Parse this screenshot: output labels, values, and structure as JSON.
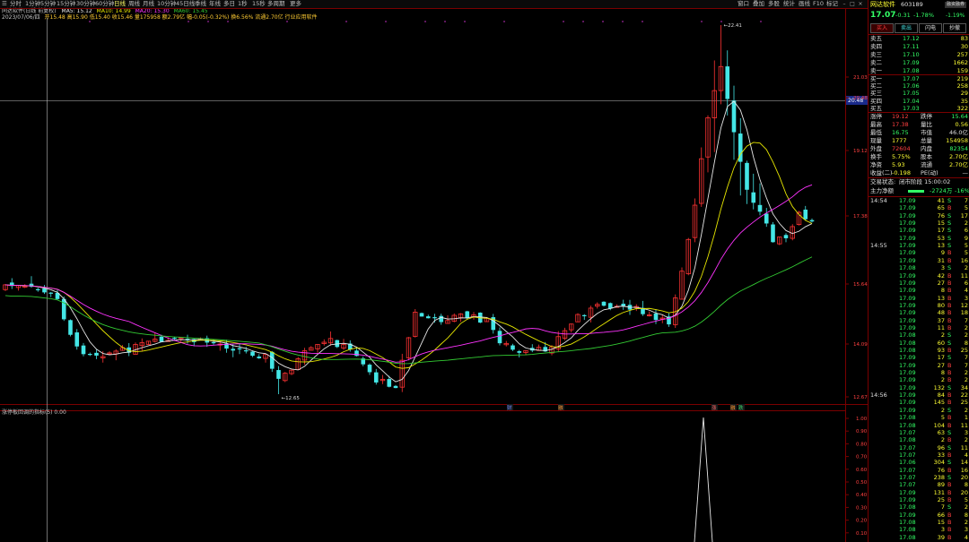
{
  "toolbar": {
    "items": [
      "日线",
      "分时",
      "1分钟",
      "5分钟",
      "15分钟",
      "30分钟",
      "60分钟",
      "日线",
      "周线",
      "月线",
      "10分钟",
      "45日线",
      "季线",
      "年线",
      "多日",
      "1秒",
      "15秒",
      "多周期",
      "更多"
    ],
    "right_items": [
      "窗口",
      "叠加",
      "多股",
      "统计",
      "画线",
      "F10",
      "标记"
    ],
    "window_buttons": [
      "–",
      "□",
      "×"
    ]
  },
  "chart_header": {
    "title_line": "同达软件(日线 前复权)",
    "ma_label": "MA5: 15.12",
    "ma10_label": "MA10: 14.99",
    "ma20_label": "MA20: 15.30",
    "ma60_label": "MA60: 15.45",
    "info_line_date": "2023/07/06/四",
    "info_line_rest": "开15.48 高15.90 低15.40 收15.46 量175958 额2.79亿 幅-0.05(-0.32%) 换6.56% 流通2.70亿 行业应用软件"
  },
  "y_axis_main": [
    "21.03",
    "20.48",
    "19.12",
    "17.38",
    "15.64",
    "14.09",
    "12.67"
  ],
  "price_cursor": "20.48",
  "annotations": {
    "high": "22.41",
    "low": "12.65"
  },
  "event_markers": [
    "财",
    "融",
    "涨",
    "融",
    "跌"
  ],
  "indicator_header": "涨停板回调的指标(5)  0.00",
  "y_axis_indicator": [
    "1.00",
    "0.90",
    "0.80",
    "0.70",
    "0.60",
    "0.50",
    "0.40",
    "0.30",
    "0.20",
    "0.10"
  ],
  "panel": {
    "name": "网达软件",
    "code": "603189",
    "tag": "融资融券",
    "price": "17.07",
    "change": "-0.31",
    "change_pct": "-1.78%",
    "pct_badge": "-1.19%",
    "buttons": [
      "买入",
      "卖出",
      "闪电",
      "抄撤"
    ],
    "asks": [
      {
        "label": "卖五",
        "price": "17.12",
        "vol": "83"
      },
      {
        "label": "卖四",
        "price": "17.11",
        "vol": "30"
      },
      {
        "label": "卖三",
        "price": "17.10",
        "vol": "257"
      },
      {
        "label": "卖二",
        "price": "17.09",
        "vol": "1662"
      },
      {
        "label": "卖一",
        "price": "17.08",
        "vol": "159"
      }
    ],
    "bids": [
      {
        "label": "买一",
        "price": "17.07",
        "vol": "219"
      },
      {
        "label": "买二",
        "price": "17.06",
        "vol": "258"
      },
      {
        "label": "买三",
        "price": "17.05",
        "vol": "29"
      },
      {
        "label": "买四",
        "price": "17.04",
        "vol": "35"
      },
      {
        "label": "买五",
        "price": "17.03",
        "vol": "322"
      }
    ],
    "stats": [
      {
        "k1": "涨停",
        "v1": "19.12",
        "k2": "跌停",
        "v2": "15.64"
      },
      {
        "k1": "最高",
        "v1": "17.38",
        "k2": "量比",
        "v2": "0.56"
      },
      {
        "k1": "最低",
        "v1": "16.75",
        "k2": "市值",
        "v2": "46.0亿"
      },
      {
        "k1": "现量",
        "v1": "1777",
        "k2": "总量",
        "v2": "154958"
      },
      {
        "k1": "外盘",
        "v1": "72604",
        "k2": "内盘",
        "v2": "82354"
      },
      {
        "k1": "换手",
        "v1": "5.75%",
        "k2": "股本",
        "v2": "2.70亿"
      },
      {
        "k1": "净资",
        "v1": "5.93",
        "k2": "流通",
        "v2": "2.70亿"
      },
      {
        "k1": "收益(二)",
        "v1": "-0.198",
        "k2": "PE(动)",
        "v2": "—"
      }
    ],
    "trade_status_label": "交易状态:",
    "trade_status_value": "闭市阶段 15:00:02",
    "main_flow_label": "主力净额",
    "main_flow_value": "-2724万",
    "main_flow_pct": "-16%",
    "ticks": [
      {
        "t": "14:54",
        "p": "17.09",
        "v": "41",
        "d": "S",
        "n": "7"
      },
      {
        "t": "",
        "p": "17.09",
        "v": "65",
        "d": "B",
        "n": "5"
      },
      {
        "t": "",
        "p": "17.09",
        "v": "76",
        "d": "S",
        "n": "17"
      },
      {
        "t": "",
        "p": "17.09",
        "v": "15",
        "d": "S",
        "n": "2"
      },
      {
        "t": "",
        "p": "17.09",
        "v": "17",
        "d": "S",
        "n": "6"
      },
      {
        "t": "",
        "p": "17.09",
        "v": "53",
        "d": "S",
        "n": "9"
      },
      {
        "t": "14:55",
        "p": "17.09",
        "v": "13",
        "d": "S",
        "n": "5"
      },
      {
        "t": "",
        "p": "17.09",
        "v": "9",
        "d": "B",
        "n": "5"
      },
      {
        "t": "",
        "p": "17.09",
        "v": "31",
        "d": "B",
        "n": "16"
      },
      {
        "t": "",
        "p": "17.08",
        "v": "3",
        "d": "S",
        "n": "2"
      },
      {
        "t": "",
        "p": "17.09",
        "v": "42",
        "d": "B",
        "n": "11"
      },
      {
        "t": "",
        "p": "17.09",
        "v": "27",
        "d": "B",
        "n": "6"
      },
      {
        "t": "",
        "p": "17.09",
        "v": "8",
        "d": "B",
        "n": "4"
      },
      {
        "t": "",
        "p": "17.09",
        "v": "13",
        "d": "B",
        "n": "3"
      },
      {
        "t": "",
        "p": "17.09",
        "v": "80",
        "d": "B",
        "n": "12"
      },
      {
        "t": "",
        "p": "17.09",
        "v": "48",
        "d": "B",
        "n": "18"
      },
      {
        "t": "",
        "p": "17.09",
        "v": "37",
        "d": "B",
        "n": "7"
      },
      {
        "t": "",
        "p": "17.09",
        "v": "11",
        "d": "B",
        "n": "2"
      },
      {
        "t": "",
        "p": "17.08",
        "v": "2",
        "d": "S",
        "n": "2"
      },
      {
        "t": "",
        "p": "17.08",
        "v": "60",
        "d": "S",
        "n": "8"
      },
      {
        "t": "",
        "p": "17.08",
        "v": "93",
        "d": "B",
        "n": "25"
      },
      {
        "t": "",
        "p": "17.09",
        "v": "17",
        "d": "S",
        "n": "7"
      },
      {
        "t": "",
        "p": "17.09",
        "v": "27",
        "d": "B",
        "n": "7"
      },
      {
        "t": "",
        "p": "17.09",
        "v": "8",
        "d": "B",
        "n": "2"
      },
      {
        "t": "",
        "p": "17.09",
        "v": "2",
        "d": "B",
        "n": "2"
      },
      {
        "t": "",
        "p": "17.09",
        "v": "132",
        "d": "S",
        "n": "34"
      },
      {
        "t": "14:56",
        "p": "17.09",
        "v": "84",
        "d": "B",
        "n": "22"
      },
      {
        "t": "",
        "p": "17.09",
        "v": "145",
        "d": "B",
        "n": "25"
      },
      {
        "t": "",
        "p": "17.09",
        "v": "2",
        "d": "S",
        "n": "2"
      },
      {
        "t": "",
        "p": "17.08",
        "v": "5",
        "d": "B",
        "n": "1"
      },
      {
        "t": "",
        "p": "17.08",
        "v": "104",
        "d": "B",
        "n": "11"
      },
      {
        "t": "",
        "p": "17.07",
        "v": "63",
        "d": "S",
        "n": "3"
      },
      {
        "t": "",
        "p": "17.08",
        "v": "2",
        "d": "B",
        "n": "2"
      },
      {
        "t": "",
        "p": "17.07",
        "v": "96",
        "d": "S",
        "n": "11"
      },
      {
        "t": "",
        "p": "17.07",
        "v": "33",
        "d": "B",
        "n": "4"
      },
      {
        "t": "",
        "p": "17.06",
        "v": "304",
        "d": "S",
        "n": "14"
      },
      {
        "t": "",
        "p": "17.07",
        "v": "76",
        "d": "B",
        "n": "16"
      },
      {
        "t": "",
        "p": "17.07",
        "v": "238",
        "d": "S",
        "n": "20"
      },
      {
        "t": "",
        "p": "17.07",
        "v": "89",
        "d": "B",
        "n": "8"
      },
      {
        "t": "",
        "p": "17.09",
        "v": "131",
        "d": "B",
        "n": "20"
      },
      {
        "t": "",
        "p": "17.09",
        "v": "25",
        "d": "B",
        "n": "5"
      },
      {
        "t": "",
        "p": "17.08",
        "v": "7",
        "d": "S",
        "n": "2"
      },
      {
        "t": "",
        "p": "17.09",
        "v": "66",
        "d": "B",
        "n": "8"
      },
      {
        "t": "",
        "p": "17.08",
        "v": "15",
        "d": "B",
        "n": "2"
      },
      {
        "t": "",
        "p": "17.08",
        "v": "3",
        "d": "B",
        "n": "3"
      },
      {
        "t": "",
        "p": "17.08",
        "v": "39",
        "d": "B",
        "n": "4"
      }
    ]
  },
  "colors": {
    "up": "#ff3333",
    "down": "#44e6e6",
    "ma5": "#e8e8e8",
    "ma10": "#e6e600",
    "ma20": "#ff33ff",
    "ma60": "#33cc33",
    "bg": "#000000",
    "frame": "#7a0000"
  }
}
